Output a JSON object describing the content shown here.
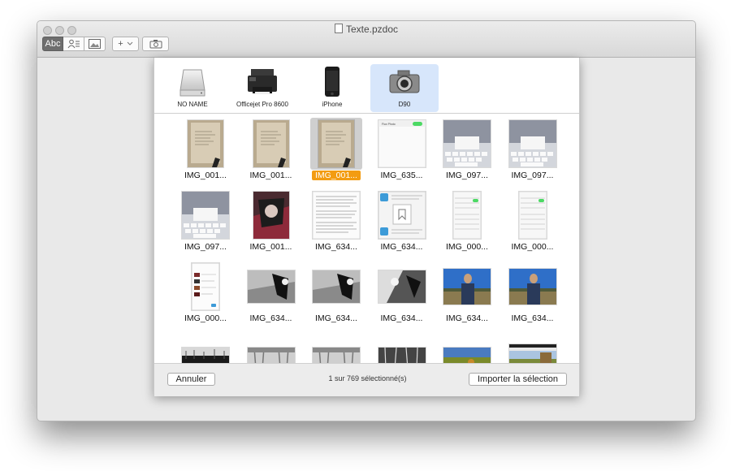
{
  "window": {
    "title": "Texte.pzdoc"
  },
  "toolbar": {
    "text_tool_label": "Abc",
    "add_label": "+"
  },
  "devices": [
    {
      "label": "NO NAME",
      "icon": "external-drive-icon",
      "selected": false
    },
    {
      "label": "Officejet Pro 8600",
      "icon": "printer-icon",
      "selected": false
    },
    {
      "label": "iPhone",
      "icon": "iphone-icon",
      "selected": false
    },
    {
      "label": "D90",
      "icon": "camera-icon",
      "selected": true
    }
  ],
  "images": [
    {
      "name": "IMG_001...",
      "kind": "paper",
      "selected": false
    },
    {
      "name": "IMG_001...",
      "kind": "paper",
      "selected": false
    },
    {
      "name": "IMG_001...",
      "kind": "paper",
      "selected": true
    },
    {
      "name": "IMG_635...",
      "kind": "screen-white",
      "selected": false
    },
    {
      "name": "IMG_097...",
      "kind": "keyboard",
      "selected": false
    },
    {
      "name": "IMG_097...",
      "kind": "keyboard",
      "selected": false
    },
    {
      "name": "IMG_097...",
      "kind": "keyboard",
      "selected": false
    },
    {
      "name": "IMG_001...",
      "kind": "photo-dark",
      "selected": false
    },
    {
      "name": "IMG_634...",
      "kind": "text-doc",
      "selected": false
    },
    {
      "name": "IMG_634...",
      "kind": "dialog",
      "selected": false
    },
    {
      "name": "IMG_000...",
      "kind": "settings",
      "selected": false
    },
    {
      "name": "IMG_000...",
      "kind": "settings",
      "selected": false
    },
    {
      "name": "IMG_000...",
      "kind": "phone-list",
      "selected": false
    },
    {
      "name": "IMG_634...",
      "kind": "bw-photo",
      "selected": false
    },
    {
      "name": "IMG_634...",
      "kind": "bw-photo",
      "selected": false
    },
    {
      "name": "IMG_634...",
      "kind": "bw-photo2",
      "selected": false
    },
    {
      "name": "IMG_634...",
      "kind": "sky-photo",
      "selected": false
    },
    {
      "name": "IMG_634...",
      "kind": "sky-photo",
      "selected": false
    },
    {
      "name": "",
      "kind": "bw-trees",
      "selected": false
    },
    {
      "name": "",
      "kind": "bw-light",
      "selected": false
    },
    {
      "name": "",
      "kind": "bw-light",
      "selected": false
    },
    {
      "name": "",
      "kind": "bw-trees2",
      "selected": false
    },
    {
      "name": "",
      "kind": "field-photo",
      "selected": false
    },
    {
      "name": "",
      "kind": "screen-field",
      "selected": false
    }
  ],
  "footer": {
    "cancel_label": "Annuler",
    "status": "1 sur 769 sélectionné(s)",
    "import_label": "Importer la sélection"
  }
}
